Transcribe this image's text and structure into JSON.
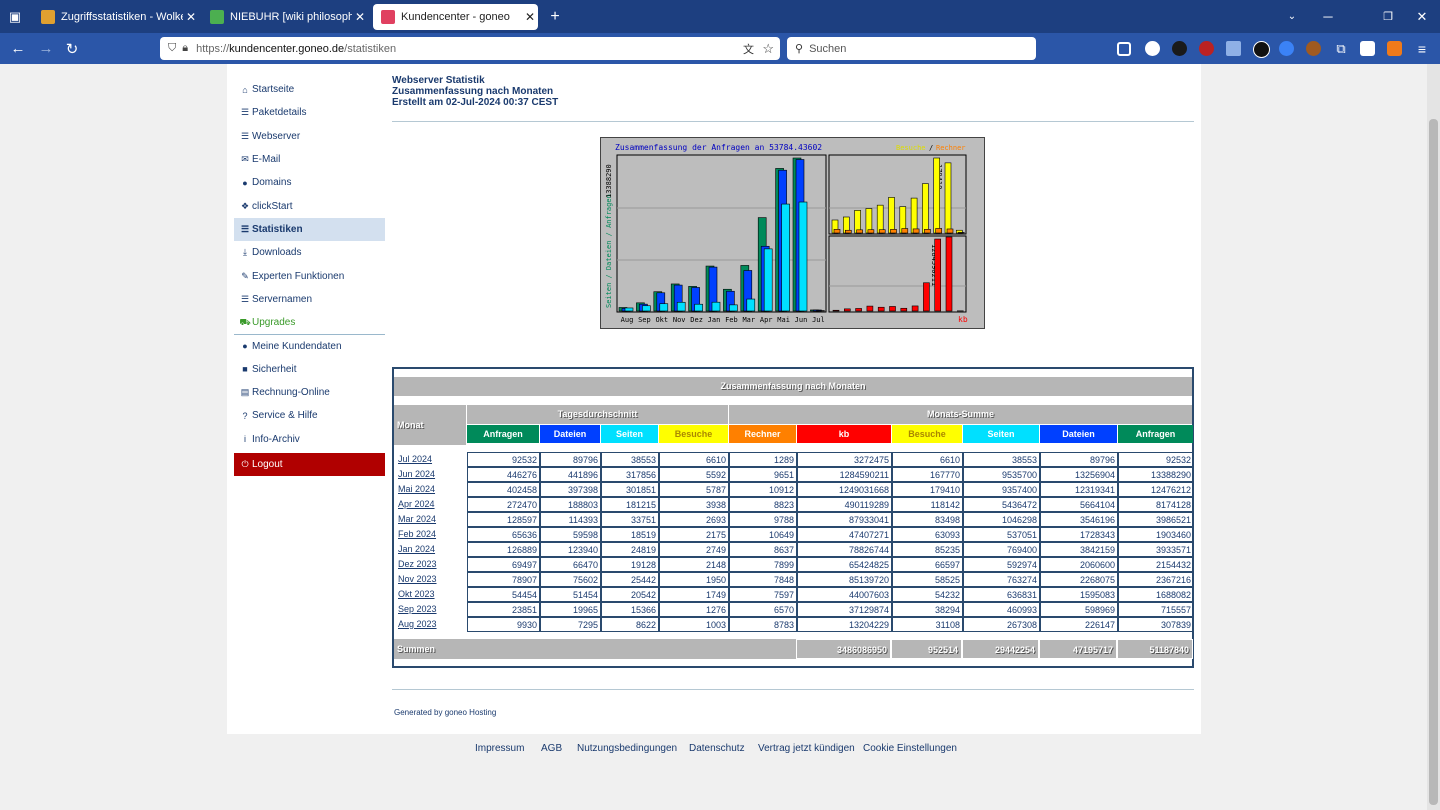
{
  "browser": {
    "tabs": [
      {
        "label": "Zugriffsstatistiken - Wolkenste",
        "active": false
      },
      {
        "label": "NIEBUHR [wiki philosophica]",
        "active": false
      },
      {
        "label": "Kundencenter - goneo",
        "active": true
      }
    ],
    "url_prefix": "https://",
    "url_host": "kundencenter.goneo.de",
    "url_path": "/statistiken",
    "search_placeholder": "Suchen"
  },
  "sidebar": {
    "items": [
      {
        "label": "Startseite",
        "icon": "home-icon",
        "glyph": "⌂"
      },
      {
        "label": "Paketdetails",
        "icon": "list-icon",
        "glyph": "☰"
      },
      {
        "label": "Webserver",
        "icon": "server-icon",
        "glyph": "☰"
      },
      {
        "label": "E-Mail",
        "icon": "envelope-icon",
        "glyph": "✉"
      },
      {
        "label": "Domains",
        "icon": "globe-icon",
        "glyph": "●"
      },
      {
        "label": "clickStart",
        "icon": "cubes-icon",
        "glyph": "❖"
      },
      {
        "label": "Statistiken",
        "icon": "stats-icon",
        "glyph": "☰"
      },
      {
        "label": "Downloads",
        "icon": "download-icon",
        "glyph": "⤓"
      },
      {
        "label": "Experten Funktionen",
        "icon": "wrench-icon",
        "glyph": "✎"
      },
      {
        "label": "Servernamen",
        "icon": "list-icon",
        "glyph": "☰"
      },
      {
        "label": "Upgrades",
        "icon": "cart-icon",
        "glyph": "⛟"
      },
      {
        "label": "Meine Kundendaten",
        "icon": "user-icon",
        "glyph": "●"
      },
      {
        "label": "Sicherheit",
        "icon": "lock-icon",
        "glyph": "■"
      },
      {
        "label": "Rechnung-Online",
        "icon": "book-icon",
        "glyph": "▤"
      },
      {
        "label": "Service & Hilfe",
        "icon": "question-icon",
        "glyph": "?"
      },
      {
        "label": "Info-Archiv",
        "icon": "info-icon",
        "glyph": "i"
      },
      {
        "label": "Logout",
        "icon": "power-icon",
        "glyph": "⏻"
      }
    ]
  },
  "header": {
    "line1": "Webserver Statistik",
    "line2": "Zusammenfassung nach Monaten",
    "line3": "Erstellt am 02-Jul-2024 00:37 CEST"
  },
  "chart_data": {
    "type": "bar",
    "title": "Zusammenfassung der Anfragen an 53784.43602",
    "left_axis_label": "Seiten / Dateien / Anfragen",
    "left_axis_max_label": "13388290",
    "right_top_max_label": "179410",
    "right_bottom_max_label": "1284590211",
    "legend_top": [
      "Besuche",
      "Rechner"
    ],
    "legend_bottom": "kb",
    "categories": [
      "Aug",
      "Sep",
      "Okt",
      "Nov",
      "Dez",
      "Jan",
      "Feb",
      "Mar",
      "Apr",
      "Mai",
      "Jun",
      "Jul"
    ],
    "series": [
      {
        "name": "Anfragen",
        "values": [
          307839,
          715557,
          1688082,
          2367216,
          2154432,
          3933571,
          1903460,
          3986521,
          8174128,
          12476212,
          13388290,
          92532
        ]
      },
      {
        "name": "Dateien",
        "values": [
          226147,
          598969,
          1595083,
          2268075,
          2060600,
          3842159,
          1728343,
          3546196,
          5664104,
          12319341,
          13256904,
          89796
        ]
      },
      {
        "name": "Seiten",
        "values": [
          267308,
          460993,
          636831,
          763274,
          592974,
          769400,
          537051,
          1046298,
          5436472,
          9357400,
          9535700,
          38553
        ]
      },
      {
        "name": "Besuche",
        "values": [
          31108,
          38294,
          54232,
          58525,
          66597,
          85235,
          63093,
          83498,
          118142,
          179410,
          167770,
          6610
        ]
      },
      {
        "name": "Rechner",
        "values": [
          8783,
          6570,
          7597,
          7848,
          7899,
          8637,
          10649,
          9788,
          8823,
          10912,
          9651,
          1289
        ]
      },
      {
        "name": "kb",
        "values": [
          13204229,
          37129874,
          44007603,
          85139720,
          65424825,
          78826744,
          47407271,
          87933041,
          490119289,
          1249031668,
          1284590211,
          3272475
        ]
      }
    ],
    "colors": {
      "Anfragen": "#008a5a",
      "Dateien": "#0040ff",
      "Seiten": "#00e0ff",
      "Besuche": "#ffff00",
      "Rechner": "#ff8000",
      "kb": "#ff0000"
    }
  },
  "table": {
    "title": "Zusammenfassung nach Monaten",
    "month_header": "Monat",
    "group_daily": "Tagesdurchschnitt",
    "group_monthly": "Monats-Summe",
    "daily_headers": [
      "Anfragen",
      "Dateien",
      "Seiten",
      "Besuche"
    ],
    "monthly_headers": [
      "Rechner",
      "kb",
      "Besuche",
      "Seiten",
      "Dateien",
      "Anfragen"
    ],
    "rows": [
      [
        "Jul 2024",
        "92532",
        "89796",
        "38553",
        "6610",
        "1289",
        "3272475",
        "6610",
        "38553",
        "89796",
        "92532"
      ],
      [
        "Jun 2024",
        "446276",
        "441896",
        "317856",
        "5592",
        "9651",
        "1284590211",
        "167770",
        "9535700",
        "13256904",
        "13388290"
      ],
      [
        "Mai 2024",
        "402458",
        "397398",
        "301851",
        "5787",
        "10912",
        "1249031668",
        "179410",
        "9357400",
        "12319341",
        "12476212"
      ],
      [
        "Apr 2024",
        "272470",
        "188803",
        "181215",
        "3938",
        "8823",
        "490119289",
        "118142",
        "5436472",
        "5664104",
        "8174128"
      ],
      [
        "Mar 2024",
        "128597",
        "114393",
        "33751",
        "2693",
        "9788",
        "87933041",
        "83498",
        "1046298",
        "3546196",
        "3986521"
      ],
      [
        "Feb 2024",
        "65636",
        "59598",
        "18519",
        "2175",
        "10649",
        "47407271",
        "63093",
        "537051",
        "1728343",
        "1903460"
      ],
      [
        "Jan 2024",
        "126889",
        "123940",
        "24819",
        "2749",
        "8637",
        "78826744",
        "85235",
        "769400",
        "3842159",
        "3933571"
      ],
      [
        "Dez 2023",
        "69497",
        "66470",
        "19128",
        "2148",
        "7899",
        "65424825",
        "66597",
        "592974",
        "2060600",
        "2154432"
      ],
      [
        "Nov 2023",
        "78907",
        "75602",
        "25442",
        "1950",
        "7848",
        "85139720",
        "58525",
        "763274",
        "2268075",
        "2367216"
      ],
      [
        "Okt 2023",
        "54454",
        "51454",
        "20542",
        "1749",
        "7597",
        "44007603",
        "54232",
        "636831",
        "1595083",
        "1688082"
      ],
      [
        "Sep 2023",
        "23851",
        "19965",
        "15366",
        "1276",
        "6570",
        "37129874",
        "38294",
        "460993",
        "598969",
        "715557"
      ],
      [
        "Aug 2023",
        "9930",
        "7295",
        "8622",
        "1003",
        "8783",
        "13204229",
        "31108",
        "267308",
        "226147",
        "307839"
      ]
    ],
    "totals_label": "Summen",
    "totals": [
      "3486086950",
      "952514",
      "29442254",
      "47195717",
      "51187840"
    ]
  },
  "generated_by": "Generated by goneo Hosting",
  "footer_links": [
    "Impressum",
    "AGB",
    "Nutzungsbedingungen",
    "Datenschutz",
    "Vertrag jetzt kündigen",
    "Cookie Einstellungen"
  ]
}
